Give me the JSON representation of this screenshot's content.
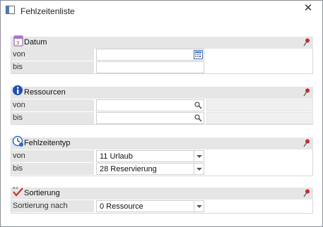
{
  "window": {
    "title": "Fehlzeitenliste",
    "close_symbol": "✕"
  },
  "datum": {
    "title": "Datum",
    "von_label": "von",
    "bis_label": "bis",
    "von_value": "",
    "bis_value": ""
  },
  "ressourcen": {
    "title": "Ressourcen",
    "von_label": "von",
    "bis_label": "bis",
    "von_value": "",
    "bis_value": ""
  },
  "fehlzeitentyp": {
    "title": "Fehlzeitentyp",
    "von_label": "von",
    "bis_label": "bis",
    "von_value": "11 Urlaub",
    "bis_value": "28 Reservierung"
  },
  "sortierung": {
    "title": "Sortierung",
    "label": "Sortierung nach",
    "value": "0 Ressource"
  }
}
